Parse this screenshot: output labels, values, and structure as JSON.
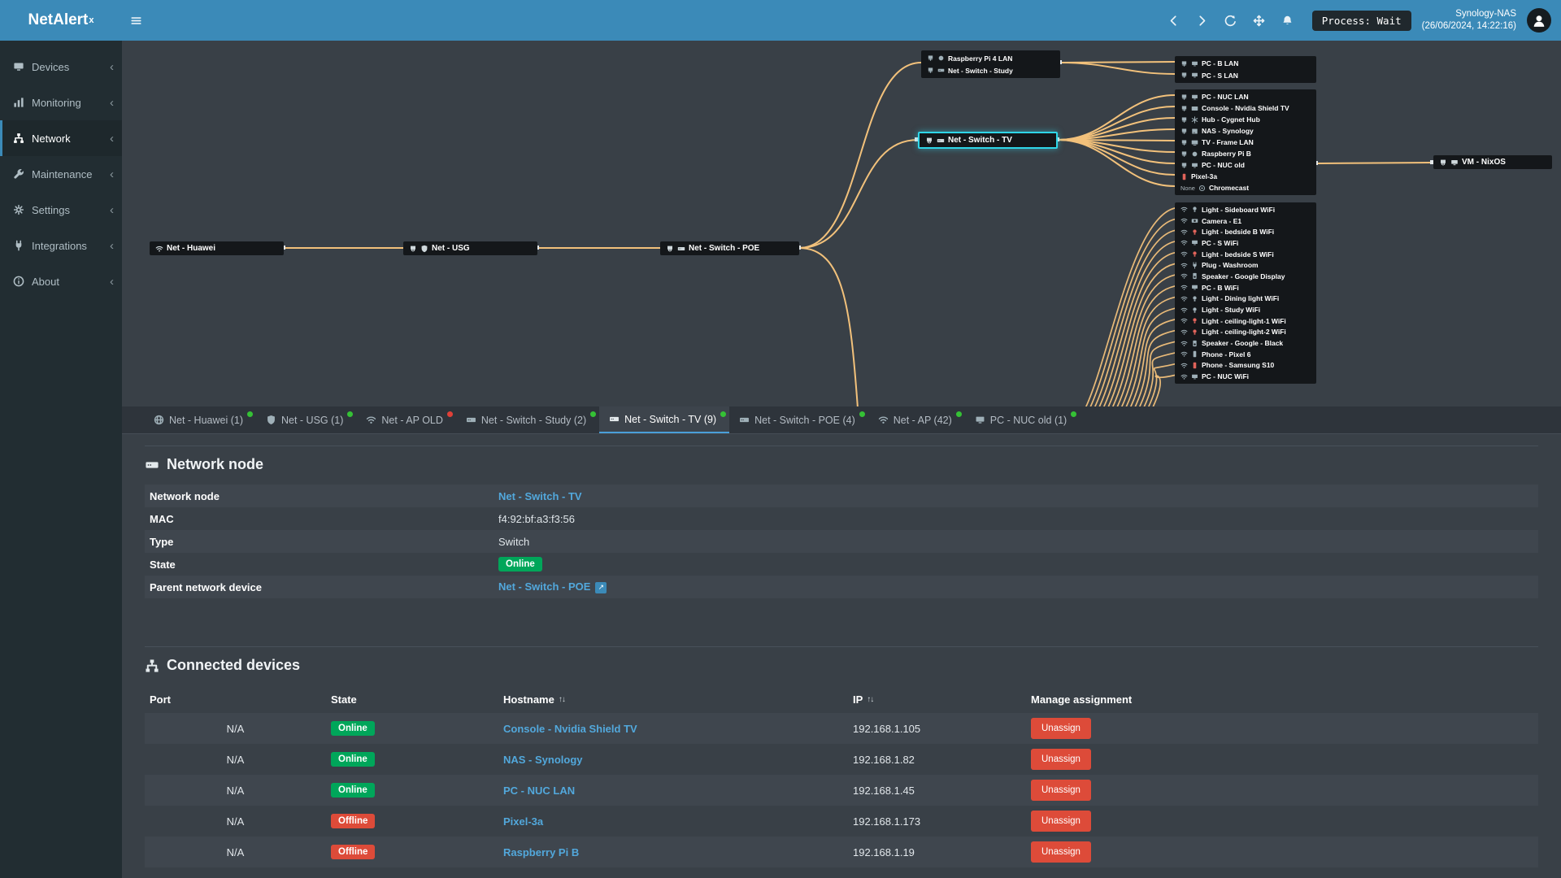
{
  "app": {
    "title": "NetAlert",
    "title_sup": "x"
  },
  "topbar": {
    "process_badge": "Process: Wait",
    "server_name": "Synology-NAS",
    "server_time": "(26/06/2024, 14:22:16)"
  },
  "sidebar": {
    "items": [
      {
        "label": "Devices",
        "icon": "monitor"
      },
      {
        "label": "Monitoring",
        "icon": "chart"
      },
      {
        "label": "Network",
        "icon": "sitemap",
        "active": true
      },
      {
        "label": "Maintenance",
        "icon": "wrench"
      },
      {
        "label": "Settings",
        "icon": "gear"
      },
      {
        "label": "Integrations",
        "icon": "plug"
      },
      {
        "label": "About",
        "icon": "info"
      }
    ]
  },
  "map": {
    "edge_color": "#f2c17b",
    "selection_color": "#2fd6e8",
    "chain": [
      {
        "label": "Net - Huawei",
        "icons": [
          "wifi"
        ]
      },
      {
        "label": "Net - USG",
        "icons": [
          "eth",
          "shield"
        ]
      },
      {
        "label": "Net - Switch - POE",
        "icons": [
          "eth",
          "switch"
        ]
      }
    ],
    "study_group": [
      {
        "label": "Raspberry Pi 4 LAN",
        "icons": [
          "eth",
          "pi"
        ]
      },
      {
        "label": "Net - Switch - Study",
        "icons": [
          "eth",
          "switch"
        ]
      }
    ],
    "tv_node": {
      "label": "Net - Switch - TV",
      "icons": [
        "eth",
        "switch"
      ],
      "selected": true
    },
    "vm_node": {
      "label": "VM - NixOS",
      "icons": [
        "eth",
        "pc"
      ]
    },
    "col_a": [
      {
        "label": "PC - B LAN",
        "icons": [
          "eth",
          "pc"
        ]
      },
      {
        "label": "PC - S LAN",
        "icons": [
          "eth",
          "pc"
        ]
      }
    ],
    "col_b": [
      {
        "label": "PC - NUC LAN",
        "icons": [
          "eth",
          "pc"
        ]
      },
      {
        "label": "Console - Nvidia Shield TV",
        "icons": [
          "eth",
          "cast"
        ]
      },
      {
        "label": "Hub - Cygnet Hub",
        "icons": [
          "eth",
          "hub"
        ]
      },
      {
        "label": "NAS - Synology",
        "icons": [
          "eth",
          "nas"
        ]
      },
      {
        "label": "TV - Frame LAN",
        "icons": [
          "eth",
          "tv"
        ]
      },
      {
        "label": "Raspberry Pi B",
        "icons": [
          "eth",
          "pi"
        ]
      },
      {
        "label": "PC - NUC old",
        "icons": [
          "eth",
          "pc"
        ]
      },
      {
        "label": "Pixel-3a",
        "icons": [
          "phone"
        ],
        "red": true
      },
      {
        "label": "Chromecast",
        "icons": [
          "chromecast"
        ],
        "prefix": "None"
      }
    ],
    "col_c": [
      {
        "label": "Light - Sideboard WiFi",
        "icons": [
          "wifi",
          "bulb"
        ]
      },
      {
        "label": "Camera - E1",
        "icons": [
          "wifi",
          "camera"
        ]
      },
      {
        "label": "Light - bedside B WiFi",
        "icons": [
          "wifi",
          "bulb"
        ],
        "red": true
      },
      {
        "label": "PC - S WiFi",
        "icons": [
          "wifi",
          "pc"
        ]
      },
      {
        "label": "Light - bedside S WiFi",
        "icons": [
          "wifi",
          "bulb"
        ],
        "red": true
      },
      {
        "label": "Plug - Washroom",
        "icons": [
          "wifi",
          "plug"
        ]
      },
      {
        "label": "Speaker - Google Display",
        "icons": [
          "wifi",
          "speaker"
        ]
      },
      {
        "label": "PC - B WiFi",
        "icons": [
          "wifi",
          "pc"
        ]
      },
      {
        "label": "Light - Dining light WiFi",
        "icons": [
          "wifi",
          "bulb"
        ]
      },
      {
        "label": "Light - Study WiFi",
        "icons": [
          "wifi",
          "bulb"
        ]
      },
      {
        "label": "Light - ceiling-light-1 WiFi",
        "icons": [
          "wifi",
          "bulb"
        ],
        "red": true
      },
      {
        "label": "Light - ceiling-light-2 WiFi",
        "icons": [
          "wifi",
          "bulb"
        ],
        "red": true
      },
      {
        "label": "Speaker - Google - Black",
        "icons": [
          "wifi",
          "speaker"
        ]
      },
      {
        "label": "Phone - Pixel 6",
        "icons": [
          "wifi",
          "phone"
        ]
      },
      {
        "label": "Phone - Samsung S10",
        "icons": [
          "wifi",
          "phone"
        ],
        "red": true
      },
      {
        "label": "PC - NUC WiFi",
        "icons": [
          "wifi",
          "pc"
        ]
      }
    ]
  },
  "tabs": [
    {
      "label": "Net - Huawei (1)",
      "icon": "globe",
      "dot": "green"
    },
    {
      "label": "Net - USG (1)",
      "icon": "shield",
      "dot": "green"
    },
    {
      "label": "Net - AP OLD",
      "icon": "wifi",
      "dot": "red"
    },
    {
      "label": "Net - Switch - Study (2)",
      "icon": "switch",
      "dot": "green"
    },
    {
      "label": "Net - Switch - TV (9)",
      "icon": "switch",
      "dot": "green",
      "active": true
    },
    {
      "label": "Net - Switch - POE (4)",
      "icon": "switch",
      "dot": "green"
    },
    {
      "label": "Net - AP (42)",
      "icon": "wifi",
      "dot": "green"
    },
    {
      "label": "PC - NUC old (1)",
      "icon": "pc",
      "dot": "green"
    }
  ],
  "node_details": {
    "section_title": "Network node",
    "rows": [
      {
        "label": "Network node",
        "value": "Net - Switch - TV",
        "type": "link"
      },
      {
        "label": "MAC",
        "value": "f4:92:bf:a3:f3:56",
        "type": "text"
      },
      {
        "label": "Type",
        "value": "Switch",
        "type": "text"
      },
      {
        "label": "State",
        "value": "Online",
        "type": "badge-online"
      },
      {
        "label": "Parent network device",
        "value": "Net - Switch - POE",
        "type": "link-ext"
      }
    ]
  },
  "connected_devices": {
    "section_title": "Connected devices",
    "columns": [
      "Port",
      "State",
      "Hostname",
      "IP",
      "Manage assignment"
    ],
    "unassign_label": "Unassign",
    "rows": [
      {
        "port": "N/A",
        "state": "Online",
        "hostname": "Console - Nvidia Shield TV",
        "ip": "192.168.1.105"
      },
      {
        "port": "N/A",
        "state": "Online",
        "hostname": "NAS - Synology",
        "ip": "192.168.1.82"
      },
      {
        "port": "N/A",
        "state": "Online",
        "hostname": "PC - NUC LAN",
        "ip": "192.168.1.45"
      },
      {
        "port": "N/A",
        "state": "Offline",
        "hostname": "Pixel-3a",
        "ip": "192.168.1.173"
      },
      {
        "port": "N/A",
        "state": "Offline",
        "hostname": "Raspberry Pi B",
        "ip": "192.168.1.19"
      }
    ]
  },
  "status_colors": {
    "online": "#00a65a",
    "offline": "#dd4b39",
    "accent": "#3b8ab8",
    "link": "#52a8dc"
  }
}
